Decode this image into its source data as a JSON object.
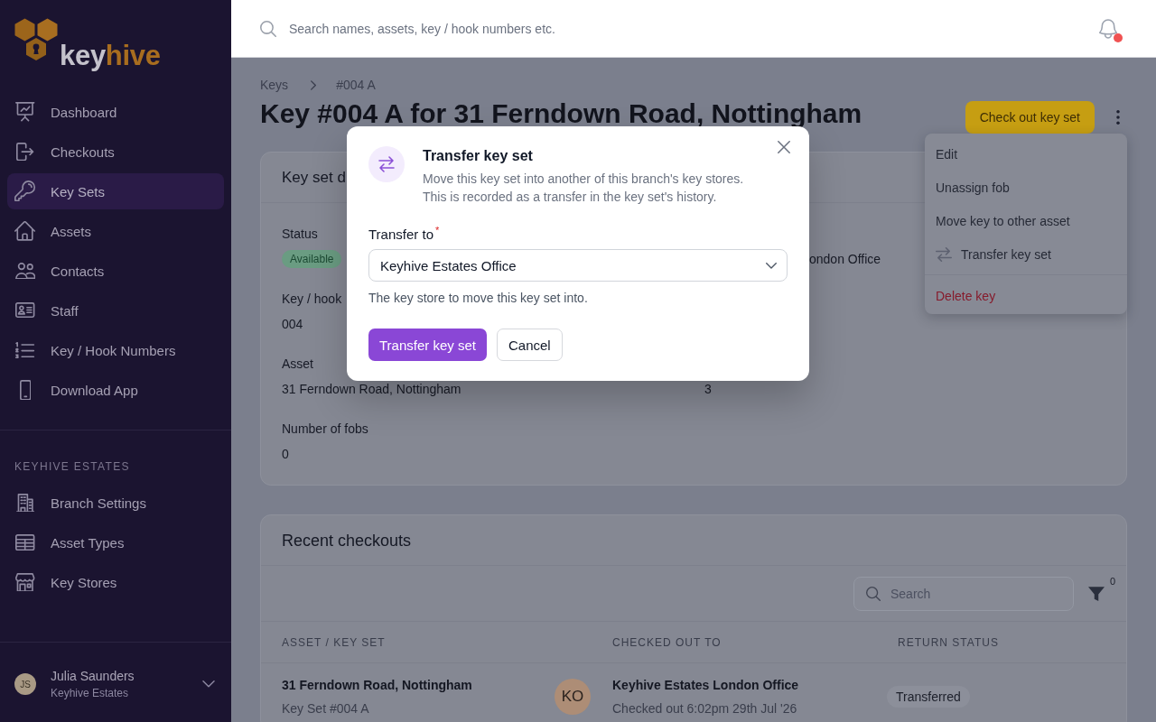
{
  "sidebar": {
    "logo": {
      "parts": [
        "key",
        "hive"
      ]
    },
    "nav_items": [
      {
        "label": "Dashboard",
        "selected": false
      },
      {
        "label": "Checkouts",
        "selected": false
      },
      {
        "label": "Key Sets",
        "selected": true
      },
      {
        "label": "Assets",
        "selected": false
      },
      {
        "label": "Contacts",
        "selected": false
      },
      {
        "label": "Staff",
        "selected": false
      },
      {
        "label": "Key / Hook Numbers",
        "selected": false
      },
      {
        "label": "Download App",
        "selected": false
      }
    ],
    "branch_section": {
      "title": "KEYHIVE ESTATES",
      "items": [
        {
          "label": "Branch Settings",
          "selected": false
        },
        {
          "label": "Asset Types",
          "selected": false
        },
        {
          "label": "Key Stores",
          "selected": false
        }
      ]
    },
    "user": {
      "initials": "JS",
      "name": "Julia Saunders",
      "organisation": "Keyhive Estates"
    }
  },
  "header": {
    "search": {
      "placeholder": "Search names, assets, key / hook numbers etc."
    },
    "notifications": {
      "has_unread": true
    }
  },
  "breadcrumb": [
    "Keys",
    "#004 A"
  ],
  "page_title": "Key #004 A for 31 Ferndown Road, Nottingham",
  "primary_action": "Check out key set",
  "actions_menu": {
    "items": [
      {
        "label": "Edit",
        "kind": "plain"
      },
      {
        "label": "Unassign fob",
        "kind": "plain"
      },
      {
        "label": "Move key to other asset",
        "kind": "plain"
      },
      {
        "label": "Transfer key set",
        "kind": "icon"
      },
      {
        "label": "Delete key",
        "kind": "danger"
      }
    ]
  },
  "key_set_details": {
    "title": "Key set d",
    "fields": [
      {
        "label": "Status",
        "kind": "badge",
        "value": "Available",
        "column_2_value": "ondon Office"
      },
      {
        "label": "Key / hook",
        "kind": "text",
        "value": "004"
      },
      {
        "label": "Asset",
        "kind": "text",
        "value": "31 Ferndown Road, Nottingham",
        "column_2_value": "3"
      },
      {
        "label": "Number of fobs",
        "kind": "text",
        "value": "0"
      }
    ]
  },
  "recent_checkouts": {
    "title": "Recent checkouts",
    "search": {
      "placeholder": "Search"
    },
    "filter_count": "0",
    "table": {
      "columns": [
        "ASSET / KEY SET",
        "CHECKED OUT TO",
        "RETURN STATUS"
      ],
      "rows": [
        {
          "asset": "31 Ferndown Road, Nottingham",
          "key_set": "Key Set #004 A",
          "avatar_initials": "KO",
          "checked_out_to": "Keyhive Estates London Office",
          "checked_out_at": "Checked out 6:02pm 29th Jul '26",
          "return_status": "Transferred"
        }
      ]
    }
  },
  "dialog": {
    "title": "Transfer key set",
    "description": "Move this key set into another of this branch's key stores. This is recorded as a transfer in the key set's history.",
    "field": {
      "label": "Transfer to",
      "required_mark": "*",
      "value": "Keyhive Estates Office",
      "help": "The key store to move this key set into."
    },
    "buttons": [
      {
        "label": "Transfer key set",
        "kind": "primary"
      },
      {
        "label": "Cancel",
        "kind": "secondary"
      }
    ]
  }
}
